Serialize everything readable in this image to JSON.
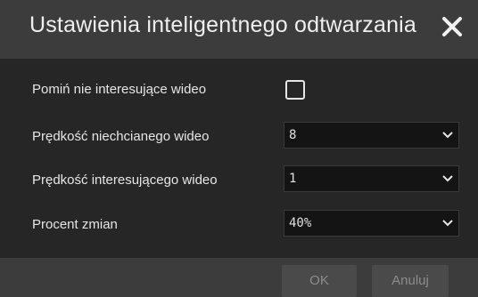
{
  "dialog": {
    "title": "Ustawienia inteligentnego odtwarzania",
    "close_icon": "close-icon"
  },
  "settings": {
    "skip_uninteresting": {
      "label": "Pomiń nie interesujące wideo",
      "checked": false
    },
    "unwanted_speed": {
      "label": "Prędkość niechcianego wideo",
      "value": "8"
    },
    "interesting_speed": {
      "label": "Prędkość interesującego wideo",
      "value": "1"
    },
    "change_percent": {
      "label": "Procent zmian",
      "value": "40%"
    }
  },
  "footer": {
    "ok_label": "OK",
    "cancel_label": "Anuluj"
  },
  "colors": {
    "title_bar": "#3c3c3c",
    "body": "#262626",
    "select_bg": "#141414",
    "button_bg": "#4a4a4a",
    "button_text": "#8c8c8c"
  }
}
